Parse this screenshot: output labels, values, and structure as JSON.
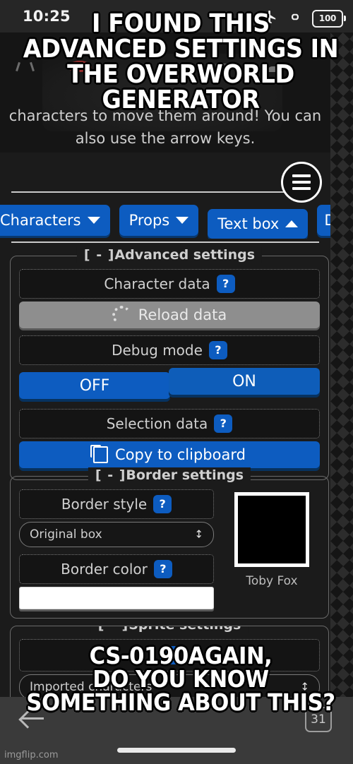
{
  "status_bar": {
    "time": "10:25",
    "icons": [
      "airplane-icon",
      "link-icon",
      "battery-icon"
    ],
    "battery_level": "100"
  },
  "canvas": {
    "instruction_line1": "characters to move them around! You can",
    "instruction_line2": "also use the arrow keys.",
    "menu_icon": "hamburger-menu-icon"
  },
  "tabs": [
    {
      "label": "Characters",
      "chevron": "down"
    },
    {
      "label": "Props",
      "chevron": "down"
    },
    {
      "label": "Text box",
      "chevron": "up"
    },
    {
      "label": "D",
      "chevron": "none"
    }
  ],
  "advanced_settings": {
    "legend_bracket": "[ - ]",
    "legend": "Advanced settings",
    "character_data": {
      "label": "Character data",
      "help": "?",
      "button_label": "Reload data",
      "button_icon": "spinner-icon",
      "button_state": "disabled"
    },
    "debug_mode": {
      "label": "Debug mode",
      "help": "?",
      "off_label": "OFF",
      "on_label": "ON"
    },
    "selection_data": {
      "label": "Selection data",
      "help": "?",
      "button_label": "Copy to clipboard",
      "button_icon": "copy-icon"
    }
  },
  "border_settings": {
    "legend_bracket": "[ - ]",
    "legend": "Border settings",
    "style": {
      "label": "Border style",
      "help": "?",
      "selected": "Original box"
    },
    "color": {
      "label": "Border color",
      "help": "?",
      "value": "#ffffff"
    },
    "preview": {
      "caption": "Toby Fox",
      "fill": "#000000",
      "frame": "#ffffff"
    }
  },
  "sprite_settings": {
    "legend_bracket": "[ - ]",
    "legend": "Sprite settings",
    "source": {
      "selected": "Imported characters"
    }
  },
  "browser_bar": {
    "back_icon": "back-arrow-icon",
    "tab_count": "31",
    "watermark": "imgflip.com"
  },
  "meme": {
    "top_lines": [
      "I FOUND THIS",
      "ADVANCED SETTINGS IN",
      "THE OVERWORLD GENERATOR"
    ],
    "bottom_lines": [
      "CS-0190AGAIN,",
      "DO YOU KNOW",
      "SOMETHING ABOUT THIS?"
    ]
  },
  "colors": {
    "accent_blue": "#0d5cc0",
    "accent_blue_shadow": "#07325f",
    "page_bg": "#1b1b1b",
    "status_bg": "#262626",
    "browser_bg": "#3a3a3a",
    "muted_text": "#cfcfcf",
    "disabled_grey": "#8e8e8e"
  }
}
